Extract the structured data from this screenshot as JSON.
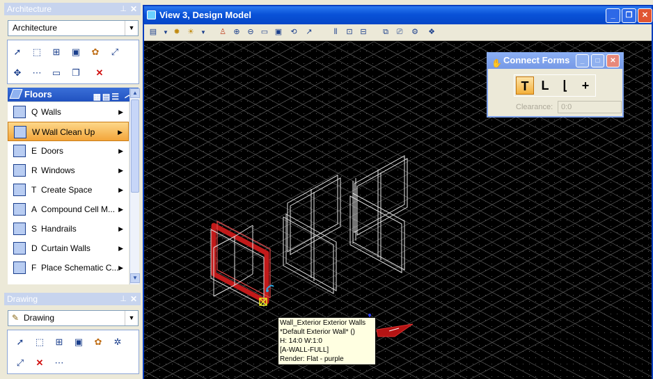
{
  "architecture_panel": {
    "title": "Architecture",
    "combo_value": "Architecture",
    "tools": [
      {
        "icon": "select-arrow-icon",
        "num": "1"
      },
      {
        "icon": "marquee-select-icon",
        "num": "2"
      },
      {
        "icon": "place-element-icon",
        "num": "3"
      },
      {
        "icon": "view-measure-icon",
        "num": "4"
      },
      {
        "icon": "palette-icon",
        "num": "5"
      },
      {
        "icon": "scale-icon",
        "num": "6"
      },
      {
        "icon": "move-icon",
        "num": "7"
      },
      {
        "icon": "connect-icon",
        "num": "8"
      },
      {
        "icon": "ruler-icon",
        "num": "9"
      },
      {
        "icon": "copy-icon",
        "num": "0"
      },
      {
        "icon": "delete-x-icon",
        "num": ""
      }
    ]
  },
  "floors": {
    "title": "Floors",
    "items": [
      {
        "key": "Q",
        "label": "Walls",
        "icon": "wall-icon"
      },
      {
        "key": "W",
        "label": "Wall Clean Up",
        "icon": "wall-cleanup-icon",
        "active": true
      },
      {
        "key": "E",
        "label": "Doors",
        "icon": "door-icon"
      },
      {
        "key": "R",
        "label": "Windows",
        "icon": "window-icon"
      },
      {
        "key": "T",
        "label": "Create Space",
        "icon": "space-icon"
      },
      {
        "key": "A",
        "label": "Compound Cell M...",
        "icon": "compound-cell-icon"
      },
      {
        "key": "S",
        "label": "Handrails",
        "icon": "handrail-icon"
      },
      {
        "key": "D",
        "label": "Curtain Walls",
        "icon": "curtain-wall-icon"
      },
      {
        "key": "F",
        "label": "Place Schematic C...",
        "icon": "schematic-icon"
      }
    ]
  },
  "drawing_panel": {
    "title": "Drawing",
    "combo_value": "Drawing"
  },
  "view": {
    "title": "View 3, Design Model"
  },
  "connect_forms": {
    "title": "Connect Forms",
    "clearance_label": "Clearance:",
    "clearance_value": "0:0"
  },
  "tooltip": {
    "lines": [
      "Wall_Exterior  Exterior Walls",
      "*Default Exterior Wall*  ()",
      "H: 14:0  W:1:0",
      "[A-WALL-FULL]",
      "Render: Flat - purple"
    ]
  },
  "colors": {
    "title_blue": "#0a3ebd",
    "highlight_red": "#c21a1a",
    "active_orange": "#f3a53a"
  }
}
